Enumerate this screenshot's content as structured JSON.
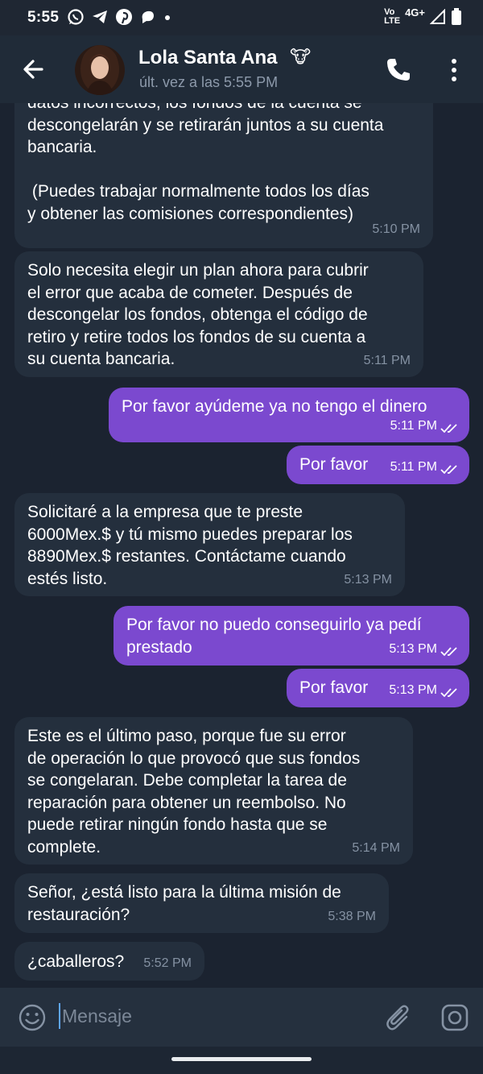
{
  "status_bar": {
    "time": "5:55",
    "network_top": "Vo",
    "network_bottom": "LTE",
    "signal": "4G+",
    "left_icons": [
      "whatsapp-icon",
      "telegram-icon",
      "pinterest-icon",
      "chat-icon",
      "dot-icon"
    ],
    "right_icons": [
      "volte-icon",
      "signal-icon",
      "battery-icon"
    ]
  },
  "header": {
    "contact_name": "Lola Santa Ana",
    "name_emoji": "🐮",
    "last_seen": "últ. vez a las 5:55 PM"
  },
  "messages": [
    {
      "dir": "in",
      "text": "datos incorrectos, los fondos de la cuenta se\ndescongelarán y se retirarán juntos a su cuenta\nbancaria.\n\n (Puedes trabajar normalmente todos los días\ny obtener las comisiones correspondientes)",
      "time": "5:10 PM"
    },
    {
      "dir": "in",
      "text": "Solo necesita elegir un plan ahora para cubrir\nel error que acaba de cometer. Después de\ndescongelar los fondos, obtenga el código de\nretiro y retire todos los fondos de su cuenta a\nsu cuenta bancaria.",
      "time": "5:11 PM"
    },
    {
      "dir": "out",
      "text": "Por favor ayúdeme ya no tengo el dinero",
      "time": "5:11 PM"
    },
    {
      "dir": "out",
      "text": "Por favor",
      "time": "5:11 PM"
    },
    {
      "dir": "in",
      "text": "Solicitaré a la empresa que te preste\n6000Mex.$ y tú mismo puedes preparar los\n8890Mex.$ restantes. Contáctame cuando\nestés listo.",
      "time": "5:13 PM"
    },
    {
      "dir": "out",
      "text": "Por favor no puedo conseguirlo ya pedí\nprestado",
      "time": "5:13 PM"
    },
    {
      "dir": "out",
      "text": "Por favor",
      "time": "5:13 PM"
    },
    {
      "dir": "in",
      "text": "Este es el último paso, porque fue su error\nde operación lo que provocó que sus fondos\nse congelaran. Debe completar la tarea de\nreparación para obtener un reembolso. No\npuede retirar ningún fondo hasta que se\ncomplete.",
      "time": "5:14 PM"
    },
    {
      "dir": "in",
      "text": "Señor, ¿está listo para la última misión de\nrestauración?",
      "time": "5:38 PM"
    },
    {
      "dir": "in",
      "text": "¿caballeros?",
      "time": "5:52 PM"
    }
  ],
  "input": {
    "placeholder": "Mensaje"
  },
  "colors": {
    "incoming_bubble": "#242f3d",
    "outgoing_bubble": "#7b49cf",
    "background": "#1b2330",
    "header": "#202b38",
    "muted_text": "#8592a3"
  }
}
